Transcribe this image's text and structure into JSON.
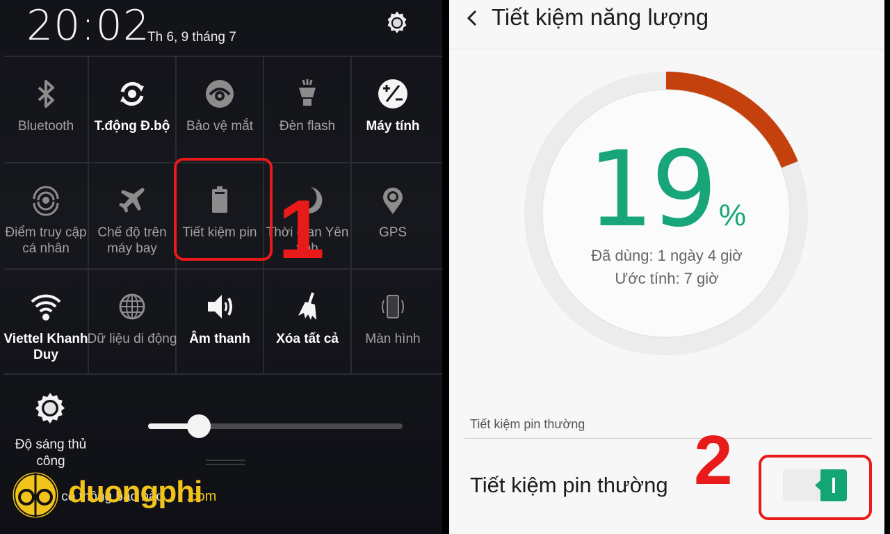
{
  "quick_panel": {
    "time": "20:02",
    "date": "Th 6, 9 tháng 7",
    "tiles": [
      [
        {
          "label": "Bluetooth",
          "icon": "bluetooth-icon",
          "active": false
        },
        {
          "label": "T.động Đ.bộ",
          "icon": "sync-icon",
          "active": true
        },
        {
          "label": "Bảo vệ mắt",
          "icon": "eye-icon",
          "active": false
        },
        {
          "label": "Đèn flash",
          "icon": "flashlight-icon",
          "active": false
        },
        {
          "label": "Máy tính",
          "icon": "calculator-icon",
          "active": true
        }
      ],
      [
        {
          "label": "Điểm truy cập cá nhân",
          "icon": "hotspot-icon",
          "active": false
        },
        {
          "label": "Chế độ trên máy bay",
          "icon": "airplane-icon",
          "active": false
        },
        {
          "label": "Tiết kiệm pin",
          "icon": "battery-icon",
          "active": false
        },
        {
          "label": "Thời gian Yên tĩnh",
          "icon": "moon-icon",
          "active": false
        },
        {
          "label": "GPS",
          "icon": "location-pin-icon",
          "active": false
        }
      ],
      [
        {
          "label": "Viettel Khanh Duy",
          "icon": "wifi-icon",
          "active": true
        },
        {
          "label": "Dữ liệu di động",
          "icon": "globe-icon",
          "active": false
        },
        {
          "label": "Âm thanh",
          "icon": "speaker-icon",
          "active": true
        },
        {
          "label": "Xóa tất cả",
          "icon": "broom-icon",
          "active": true
        },
        {
          "label": "Màn hình",
          "icon": "screen-rotate-icon",
          "active": false
        }
      ]
    ],
    "brightness": {
      "label": "Độ sáng thủ công",
      "level_percent": 20
    },
    "notifications_text": "Không có thông báo nào",
    "step_marker": "1"
  },
  "watermark": {
    "text": "duongphi",
    "suffix": ".com",
    "color": "#f2c31b"
  },
  "power_saving": {
    "title": "Tiết kiệm năng lượng",
    "battery_percent": 19,
    "percent_symbol": "%",
    "used": "Đã dùng: 1 ngày 4 giờ",
    "estimate": "Ước tính: 7 giờ",
    "section_header": "Tiết kiệm pin thường",
    "setting_label": "Tiết kiệm pin thường",
    "toggle_on": true,
    "step_marker": "2",
    "colors": {
      "ring_fill": "#c4410e",
      "ring_track": "#ececec",
      "percent_text": "#17a579",
      "toggle_on": "#14a574"
    }
  }
}
